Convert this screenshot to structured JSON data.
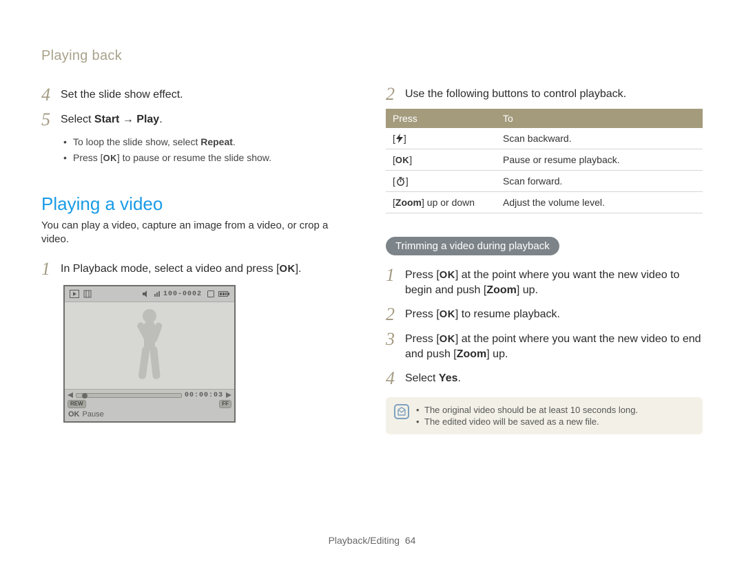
{
  "breadcrumb": "Playing back",
  "left": {
    "step4": {
      "num": "4",
      "text": "Set the slide show effect."
    },
    "step5": {
      "num": "5",
      "prefix": "Select ",
      "bold1": "Start",
      "arrow": " → ",
      "bold2": "Play",
      "suffix": ".",
      "bullets": [
        {
          "pre": "To loop the slide show, select ",
          "bold": "Repeat",
          "post": "."
        },
        {
          "pre": "Press [",
          "ok": "OK",
          "post": "] to pause or resume the slide show."
        }
      ]
    },
    "section": {
      "title": "Playing a video",
      "intro": "You can play a video, capture an image from a video, or crop a video.",
      "step1": {
        "num": "1",
        "pre": "In Playback mode, select a video and press [",
        "ok": "OK",
        "post": "]."
      }
    },
    "preview": {
      "counter": "100-0002",
      "rew": "REW",
      "ff": "FF",
      "timecode": "00:00:03",
      "ok": "OK",
      "pause": "Pause"
    }
  },
  "right": {
    "step2": {
      "num": "2",
      "text": "Use the following buttons to control playback."
    },
    "table": {
      "head": [
        "Press",
        "To"
      ],
      "rows": [
        {
          "sym": "flash",
          "label": "",
          "desc": "Scan backward."
        },
        {
          "sym": "ok",
          "label": "OK",
          "desc": "Pause or resume playback."
        },
        {
          "sym": "timer",
          "label": "",
          "desc": "Scan forward."
        },
        {
          "sym": "text",
          "label": "Zoom",
          "label_post": " up or down",
          "desc": "Adjust the volume level."
        }
      ]
    },
    "pill": "Trimming a video during playback",
    "trim_steps": {
      "s1": {
        "num": "1",
        "pre": "Press [",
        "ok": "OK",
        "mid": "] at the point where you want the new video to begin and push [",
        "bold": "Zoom",
        "post": "] up."
      },
      "s2": {
        "num": "2",
        "pre": "Press [",
        "ok": "OK",
        "post": "] to resume playback."
      },
      "s3": {
        "num": "3",
        "pre": "Press [",
        "ok": "OK",
        "mid": "] at the point where you want the new video to end and push [",
        "bold": "Zoom",
        "post": "] up."
      },
      "s4": {
        "num": "4",
        "pre": "Select ",
        "bold": "Yes",
        "post": "."
      }
    },
    "note": {
      "items": [
        "The original video should be at least 10 seconds long.",
        "The edited video will be saved as a new file."
      ]
    }
  },
  "footer": {
    "section": "Playback/Editing",
    "page": "64"
  }
}
